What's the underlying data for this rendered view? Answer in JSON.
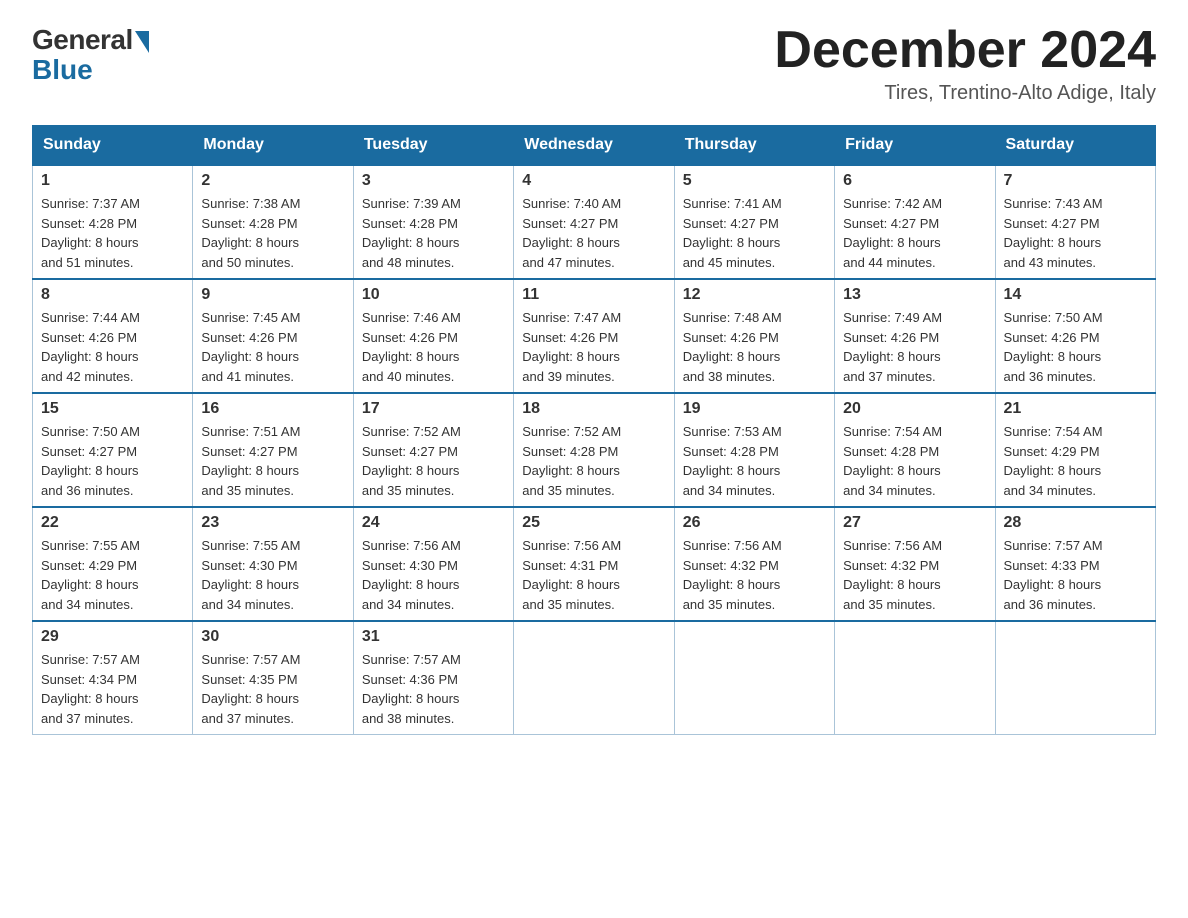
{
  "logo": {
    "general": "General",
    "blue": "Blue"
  },
  "header": {
    "month": "December 2024",
    "location": "Tires, Trentino-Alto Adige, Italy"
  },
  "days_of_week": [
    "Sunday",
    "Monday",
    "Tuesday",
    "Wednesday",
    "Thursday",
    "Friday",
    "Saturday"
  ],
  "weeks": [
    [
      {
        "day": "1",
        "sunrise": "7:37 AM",
        "sunset": "4:28 PM",
        "daylight": "8 hours and 51 minutes."
      },
      {
        "day": "2",
        "sunrise": "7:38 AM",
        "sunset": "4:28 PM",
        "daylight": "8 hours and 50 minutes."
      },
      {
        "day": "3",
        "sunrise": "7:39 AM",
        "sunset": "4:28 PM",
        "daylight": "8 hours and 48 minutes."
      },
      {
        "day": "4",
        "sunrise": "7:40 AM",
        "sunset": "4:27 PM",
        "daylight": "8 hours and 47 minutes."
      },
      {
        "day": "5",
        "sunrise": "7:41 AM",
        "sunset": "4:27 PM",
        "daylight": "8 hours and 45 minutes."
      },
      {
        "day": "6",
        "sunrise": "7:42 AM",
        "sunset": "4:27 PM",
        "daylight": "8 hours and 44 minutes."
      },
      {
        "day": "7",
        "sunrise": "7:43 AM",
        "sunset": "4:27 PM",
        "daylight": "8 hours and 43 minutes."
      }
    ],
    [
      {
        "day": "8",
        "sunrise": "7:44 AM",
        "sunset": "4:26 PM",
        "daylight": "8 hours and 42 minutes."
      },
      {
        "day": "9",
        "sunrise": "7:45 AM",
        "sunset": "4:26 PM",
        "daylight": "8 hours and 41 minutes."
      },
      {
        "day": "10",
        "sunrise": "7:46 AM",
        "sunset": "4:26 PM",
        "daylight": "8 hours and 40 minutes."
      },
      {
        "day": "11",
        "sunrise": "7:47 AM",
        "sunset": "4:26 PM",
        "daylight": "8 hours and 39 minutes."
      },
      {
        "day": "12",
        "sunrise": "7:48 AM",
        "sunset": "4:26 PM",
        "daylight": "8 hours and 38 minutes."
      },
      {
        "day": "13",
        "sunrise": "7:49 AM",
        "sunset": "4:26 PM",
        "daylight": "8 hours and 37 minutes."
      },
      {
        "day": "14",
        "sunrise": "7:50 AM",
        "sunset": "4:26 PM",
        "daylight": "8 hours and 36 minutes."
      }
    ],
    [
      {
        "day": "15",
        "sunrise": "7:50 AM",
        "sunset": "4:27 PM",
        "daylight": "8 hours and 36 minutes."
      },
      {
        "day": "16",
        "sunrise": "7:51 AM",
        "sunset": "4:27 PM",
        "daylight": "8 hours and 35 minutes."
      },
      {
        "day": "17",
        "sunrise": "7:52 AM",
        "sunset": "4:27 PM",
        "daylight": "8 hours and 35 minutes."
      },
      {
        "day": "18",
        "sunrise": "7:52 AM",
        "sunset": "4:28 PM",
        "daylight": "8 hours and 35 minutes."
      },
      {
        "day": "19",
        "sunrise": "7:53 AM",
        "sunset": "4:28 PM",
        "daylight": "8 hours and 34 minutes."
      },
      {
        "day": "20",
        "sunrise": "7:54 AM",
        "sunset": "4:28 PM",
        "daylight": "8 hours and 34 minutes."
      },
      {
        "day": "21",
        "sunrise": "7:54 AM",
        "sunset": "4:29 PM",
        "daylight": "8 hours and 34 minutes."
      }
    ],
    [
      {
        "day": "22",
        "sunrise": "7:55 AM",
        "sunset": "4:29 PM",
        "daylight": "8 hours and 34 minutes."
      },
      {
        "day": "23",
        "sunrise": "7:55 AM",
        "sunset": "4:30 PM",
        "daylight": "8 hours and 34 minutes."
      },
      {
        "day": "24",
        "sunrise": "7:56 AM",
        "sunset": "4:30 PM",
        "daylight": "8 hours and 34 minutes."
      },
      {
        "day": "25",
        "sunrise": "7:56 AM",
        "sunset": "4:31 PM",
        "daylight": "8 hours and 35 minutes."
      },
      {
        "day": "26",
        "sunrise": "7:56 AM",
        "sunset": "4:32 PM",
        "daylight": "8 hours and 35 minutes."
      },
      {
        "day": "27",
        "sunrise": "7:56 AM",
        "sunset": "4:32 PM",
        "daylight": "8 hours and 35 minutes."
      },
      {
        "day": "28",
        "sunrise": "7:57 AM",
        "sunset": "4:33 PM",
        "daylight": "8 hours and 36 minutes."
      }
    ],
    [
      {
        "day": "29",
        "sunrise": "7:57 AM",
        "sunset": "4:34 PM",
        "daylight": "8 hours and 37 minutes."
      },
      {
        "day": "30",
        "sunrise": "7:57 AM",
        "sunset": "4:35 PM",
        "daylight": "8 hours and 37 minutes."
      },
      {
        "day": "31",
        "sunrise": "7:57 AM",
        "sunset": "4:36 PM",
        "daylight": "8 hours and 38 minutes."
      },
      null,
      null,
      null,
      null
    ]
  ],
  "labels": {
    "sunrise": "Sunrise:",
    "sunset": "Sunset:",
    "daylight": "Daylight:"
  }
}
